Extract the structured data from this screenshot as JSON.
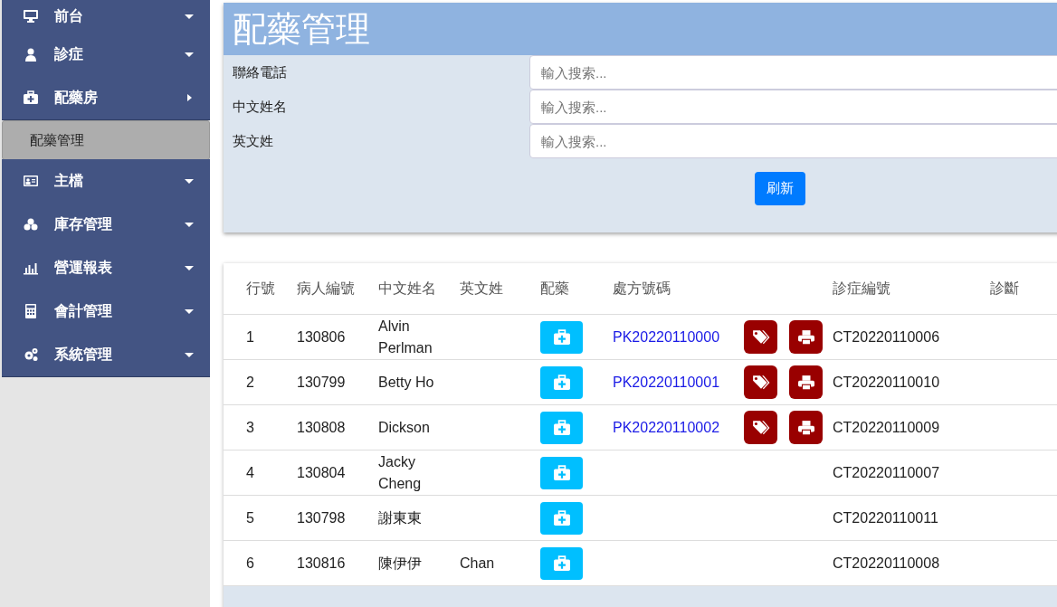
{
  "sidebar": {
    "items": [
      {
        "label": "前台",
        "expanded": false
      },
      {
        "label": "診症",
        "expanded": false
      },
      {
        "label": "配藥房",
        "expanded": true,
        "children": [
          {
            "label": "配藥管理",
            "selected": true
          }
        ]
      },
      {
        "label": "主檔",
        "expanded": false
      },
      {
        "label": "庫存管理",
        "expanded": false
      },
      {
        "label": "營運報表",
        "expanded": false
      },
      {
        "label": "會計管理",
        "expanded": false
      },
      {
        "label": "系統管理",
        "expanded": false
      }
    ]
  },
  "page_title": "配藥管理",
  "filters": [
    {
      "label": "聯絡電話",
      "placeholder": "輸入搜索..."
    },
    {
      "label": "中文姓名",
      "placeholder": "輸入搜索..."
    },
    {
      "label": "英文姓",
      "placeholder": "輸入搜索..."
    }
  ],
  "refresh_button": "刷新",
  "table": {
    "columns": [
      "行號",
      "病人編號",
      "中文姓名",
      "英文姓",
      "配藥",
      "處方號碼",
      "診症編號",
      "診斷"
    ],
    "rows": [
      {
        "no": "1",
        "patient_id": "130806",
        "chinese_name": "Alvin Perlman",
        "english_surname": "",
        "prescription_no": "PK20220110000",
        "consultation_no": "CT20220110006"
      },
      {
        "no": "2",
        "patient_id": "130799",
        "chinese_name": "Betty Ho",
        "english_surname": "",
        "prescription_no": "PK20220110001",
        "consultation_no": "CT20220110010"
      },
      {
        "no": "3",
        "patient_id": "130808",
        "chinese_name": "Dickson",
        "english_surname": "",
        "prescription_no": "PK20220110002",
        "consultation_no": "CT20220110009"
      },
      {
        "no": "4",
        "patient_id": "130804",
        "chinese_name": "Jacky Cheng",
        "english_surname": "",
        "prescription_no": "",
        "consultation_no": "CT20220110007"
      },
      {
        "no": "5",
        "patient_id": "130798",
        "chinese_name": "謝東東",
        "english_surname": "",
        "prescription_no": "",
        "consultation_no": "CT20220110011"
      },
      {
        "no": "6",
        "patient_id": "130816",
        "chinese_name": "陳伊伊",
        "english_surname": "Chan",
        "prescription_no": "",
        "consultation_no": "CT20220110008"
      }
    ]
  }
}
